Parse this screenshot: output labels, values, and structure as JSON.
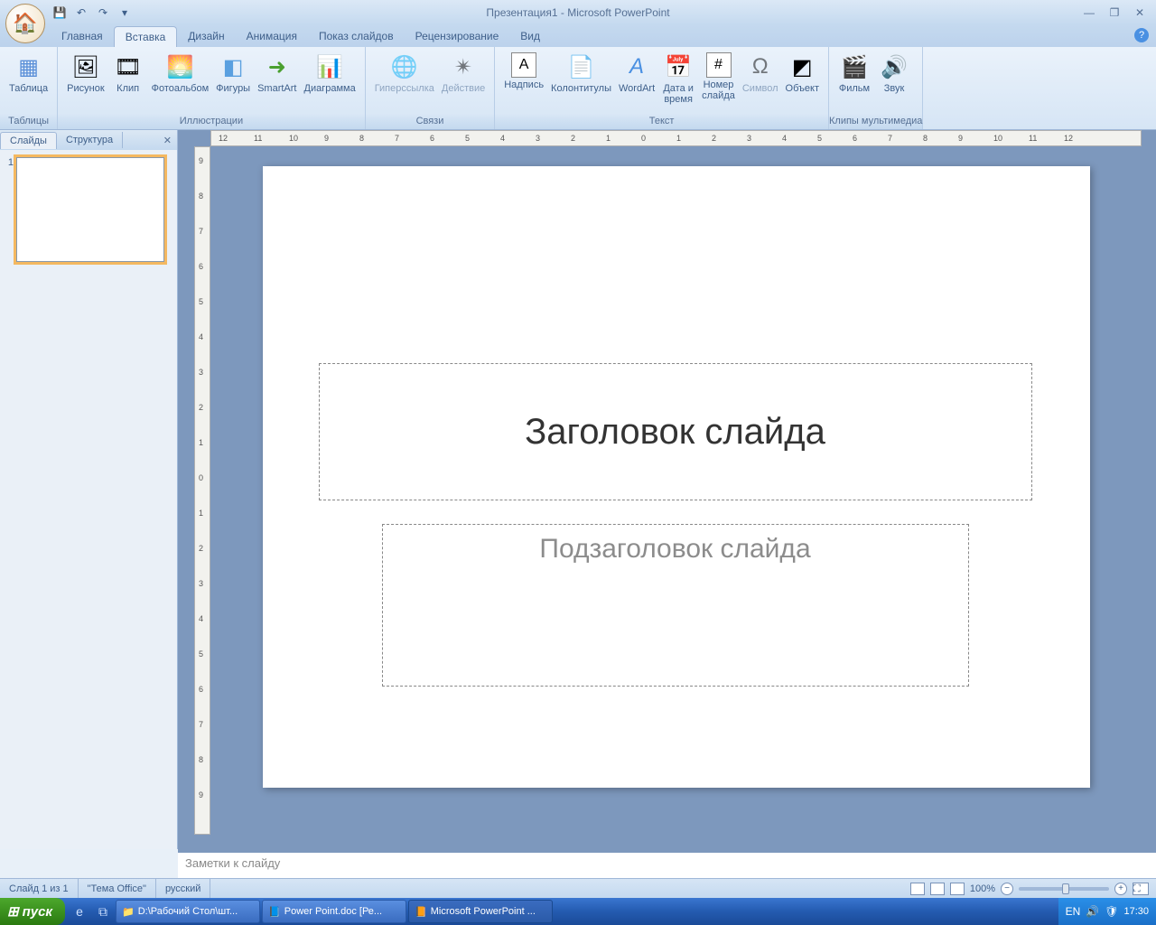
{
  "title": "Презентация1 - Microsoft PowerPoint",
  "qat": {
    "save": "💾",
    "undo": "↶",
    "redo": "↷"
  },
  "tabs": [
    "Главная",
    "Вставка",
    "Дизайн",
    "Анимация",
    "Показ слайдов",
    "Рецензирование",
    "Вид"
  ],
  "active_tab": "Вставка",
  "ribbon": {
    "groups": [
      {
        "label": "Таблицы",
        "items": [
          {
            "icon": "▦",
            "label": "Таблица",
            "color": "#5a8fd8"
          }
        ]
      },
      {
        "label": "Иллюстрации",
        "items": [
          {
            "icon": "🖼",
            "label": "Рисунок"
          },
          {
            "icon": "🎞",
            "label": "Клип"
          },
          {
            "icon": "🌅",
            "label": "Фотоальбом"
          },
          {
            "icon": "◧",
            "label": "Фигуры",
            "color": "#5aa0e0"
          },
          {
            "icon": "➜",
            "label": "SmartArt",
            "color": "#4aa030"
          },
          {
            "icon": "📊",
            "label": "Диаграмма"
          }
        ]
      },
      {
        "label": "Связи",
        "items": [
          {
            "icon": "🌐",
            "label": "Гиперссылка",
            "disabled": true
          },
          {
            "icon": "✴",
            "label": "Действие",
            "disabled": true
          }
        ]
      },
      {
        "label": "Текст",
        "items": [
          {
            "icon": "A",
            "label": "Надпись",
            "boxed": true
          },
          {
            "icon": "📄",
            "label": "Колонтитулы"
          },
          {
            "icon": "A",
            "label": "WordArt",
            "color": "#4a90e2",
            "italic": true
          },
          {
            "icon": "📅",
            "label": "Дата и\nвремя"
          },
          {
            "icon": "#",
            "label": "Номер\nслайда",
            "boxed": true
          },
          {
            "icon": "Ω",
            "label": "Символ",
            "disabled": true
          },
          {
            "icon": "◩",
            "label": "Объект"
          }
        ]
      },
      {
        "label": "Клипы мультимедиа",
        "items": [
          {
            "icon": "🎬",
            "label": "Фильм"
          },
          {
            "icon": "🔊",
            "label": "Звук",
            "color": "#d4a828"
          }
        ]
      }
    ]
  },
  "pane_tabs": [
    "Слайды",
    "Структура"
  ],
  "thumb_num": "1",
  "slide": {
    "title_placeholder": "Заголовок слайда",
    "subtitle_placeholder": "Подзаголовок слайда"
  },
  "notes_placeholder": "Заметки к слайду",
  "status": {
    "slide_info": "Слайд 1 из 1",
    "theme": "\"Тема Office\"",
    "lang": "русский",
    "zoom": "100%"
  },
  "h_ticks": [
    "12",
    "11",
    "10",
    "9",
    "8",
    "7",
    "6",
    "5",
    "4",
    "3",
    "2",
    "1",
    "0",
    "1",
    "2",
    "3",
    "4",
    "5",
    "6",
    "7",
    "8",
    "9",
    "10",
    "11",
    "12"
  ],
  "v_ticks": [
    "9",
    "8",
    "7",
    "6",
    "5",
    "4",
    "3",
    "2",
    "1",
    "0",
    "1",
    "2",
    "3",
    "4",
    "5",
    "6",
    "7",
    "8",
    "9"
  ],
  "taskbar": {
    "start": "пуск",
    "items": [
      {
        "icon": "📁",
        "label": "D:\\Рабочий Стол\\шт..."
      },
      {
        "icon": "📘",
        "label": "Power Point.doc [Ре..."
      },
      {
        "icon": "📙",
        "label": "Microsoft PowerPoint ...",
        "active": true
      }
    ],
    "tray_lang": "EN",
    "clock": "17:30"
  }
}
